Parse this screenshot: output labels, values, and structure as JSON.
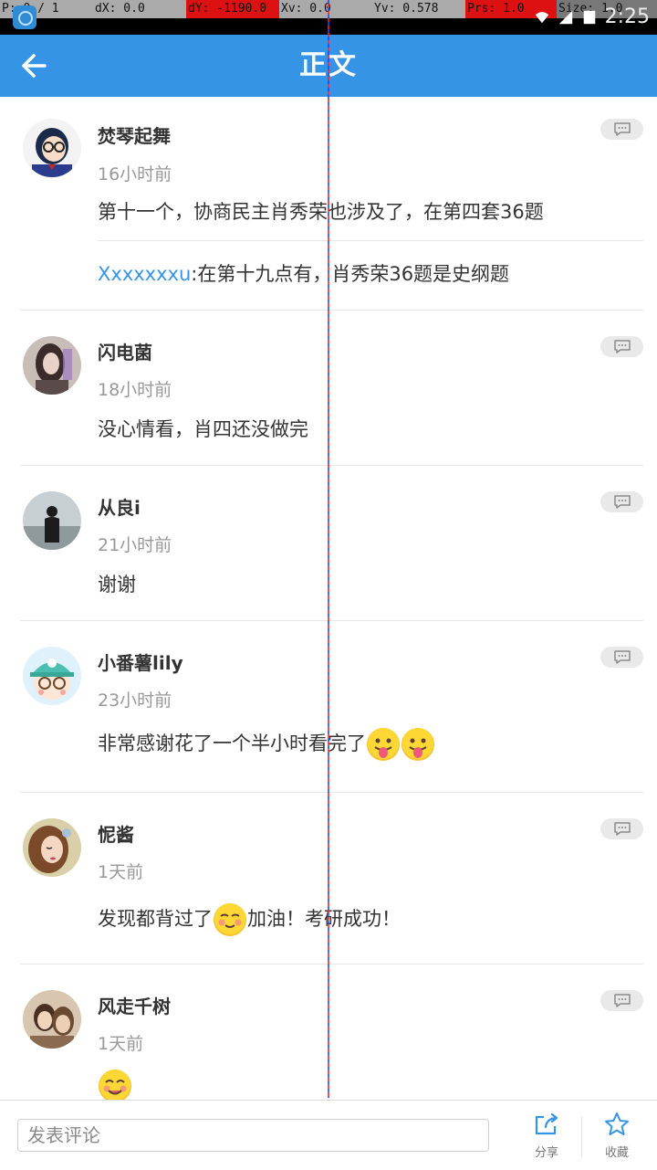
{
  "debug": {
    "p": "P: 0 / 1",
    "dx": "dX: 0.0",
    "dy": "dY: -1190.0",
    "xv": "Xv: 0.0",
    "yv": "Yv: 0.578",
    "prs": "Prs: 1.0",
    "size": "Size: 1.0"
  },
  "status_bar": {
    "time": "2:25"
  },
  "header": {
    "title": "正文",
    "back_icon": "arrow-left-icon"
  },
  "comments": [
    {
      "name": "焚琴起舞",
      "time": "16小时前",
      "text": "第十一个，协商民主肖秀荣也涉及了，在第四套36题",
      "reply": {
        "user": "Xxxxxxxu",
        "text": ":在第十九点有，肖秀荣36题是史纲题"
      }
    },
    {
      "name": "闪电菌",
      "time": "18小时前",
      "text": "没心情看，肖四还没做完"
    },
    {
      "name": "从良i",
      "time": "21小时前",
      "text": "谢谢"
    },
    {
      "name": "小番薯lily",
      "time": "23小时前",
      "text": "非常感谢花了一个半小时看完了",
      "emoji_after": [
        "tongue-emoji",
        "tongue-emoji"
      ]
    },
    {
      "name": "怩酱",
      "time": "1天前",
      "text_before": "发现都背过了",
      "emoji_mid": "blush-emoji",
      "text_after": "加油！考研成功！"
    },
    {
      "name": "风走千树",
      "time": "1天前",
      "emoji_only": "smile-emoji"
    }
  ],
  "bottom": {
    "input_placeholder": "发表评论",
    "share_label": "分享",
    "favorite_label": "收藏"
  },
  "colors": {
    "accent": "#3594e6",
    "link": "#3594e6"
  }
}
